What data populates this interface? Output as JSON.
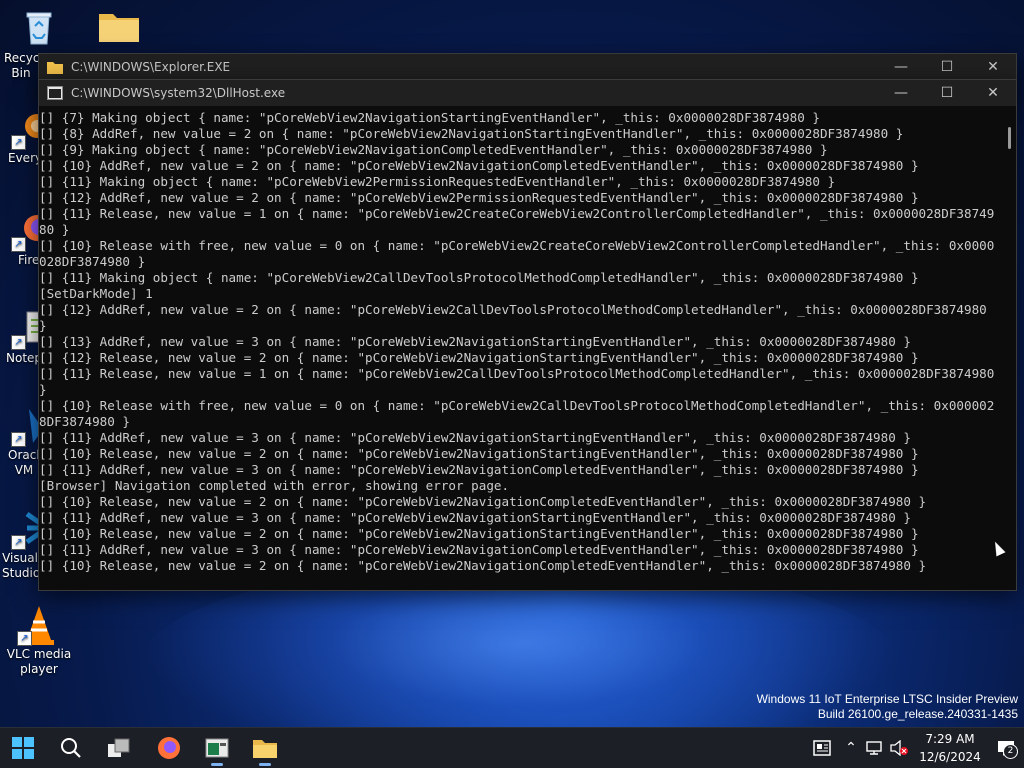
{
  "desktop": {
    "icons": [
      {
        "label": "Recycle Bin",
        "name": "recycle-bin"
      },
      {
        "label": "",
        "name": "folder"
      },
      {
        "label": "Everything",
        "name": "everything"
      },
      {
        "label": "Firefox",
        "name": "firefox"
      },
      {
        "label": "Notepad++",
        "name": "notepadpp"
      },
      {
        "label": "Oracle VM VirtualBox",
        "name": "virtualbox"
      },
      {
        "label": "Visual Studio Code",
        "name": "vscode"
      },
      {
        "label": "VLC media player",
        "name": "vlc"
      }
    ]
  },
  "windows": {
    "explorer": {
      "title": "C:\\WINDOWS\\Explorer.EXE"
    },
    "dllhost": {
      "title": "C:\\WINDOWS\\system32\\DllHost.exe",
      "lines": [
        "[] {7} Making object { name: \"pCoreWebView2NavigationStartingEventHandler\", _this: 0x0000028DF3874980 }",
        "[] {8} AddRef, new value = 2 on { name: \"pCoreWebView2NavigationStartingEventHandler\", _this: 0x0000028DF3874980 }",
        "[] {9} Making object { name: \"pCoreWebView2NavigationCompletedEventHandler\", _this: 0x0000028DF3874980 }",
        "[] {10} AddRef, new value = 2 on { name: \"pCoreWebView2NavigationCompletedEventHandler\", _this: 0x0000028DF3874980 }",
        "[] {11} Making object { name: \"pCoreWebView2PermissionRequestedEventHandler\", _this: 0x0000028DF3874980 }",
        "[] {12} AddRef, new value = 2 on { name: \"pCoreWebView2PermissionRequestedEventHandler\", _this: 0x0000028DF3874980 }",
        "[] {11} Release, new value = 1 on { name: \"pCoreWebView2CreateCoreWebView2ControllerCompletedHandler\", _this: 0x0000028DF3874980 }",
        "[] {10} Release with free, new value = 0 on { name: \"pCoreWebView2CreateCoreWebView2ControllerCompletedHandler\", _this: 0x0000028DF3874980 }",
        "[] {11} Making object { name: \"pCoreWebView2CallDevToolsProtocolMethodCompletedHandler\", _this: 0x0000028DF3874980 }",
        "[SetDarkMode] 1",
        "[] {12} AddRef, new value = 2 on { name: \"pCoreWebView2CallDevToolsProtocolMethodCompletedHandler\", _this: 0x0000028DF3874980 }",
        "[] {13} AddRef, new value = 3 on { name: \"pCoreWebView2NavigationStartingEventHandler\", _this: 0x0000028DF3874980 }",
        "[] {12} Release, new value = 2 on { name: \"pCoreWebView2NavigationStartingEventHandler\", _this: 0x0000028DF3874980 }",
        "[] {11} Release, new value = 1 on { name: \"pCoreWebView2CallDevToolsProtocolMethodCompletedHandler\", _this: 0x0000028DF3874980 }",
        "[] {10} Release with free, new value = 0 on { name: \"pCoreWebView2CallDevToolsProtocolMethodCompletedHandler\", _this: 0x0000028DF3874980 }",
        "[] {11} AddRef, new value = 3 on { name: \"pCoreWebView2NavigationStartingEventHandler\", _this: 0x0000028DF3874980 }",
        "[] {10} Release, new value = 2 on { name: \"pCoreWebView2NavigationStartingEventHandler\", _this: 0x0000028DF3874980 }",
        "[] {11} AddRef, new value = 3 on { name: \"pCoreWebView2NavigationCompletedEventHandler\", _this: 0x0000028DF3874980 }",
        "[Browser] Navigation completed with error, showing error page.",
        "[] {10} Release, new value = 2 on { name: \"pCoreWebView2NavigationCompletedEventHandler\", _this: 0x0000028DF3874980 }",
        "[] {11} AddRef, new value = 3 on { name: \"pCoreWebView2NavigationStartingEventHandler\", _this: 0x0000028DF3874980 }",
        "[] {10} Release, new value = 2 on { name: \"pCoreWebView2NavigationStartingEventHandler\", _this: 0x0000028DF3874980 }",
        "[] {11} AddRef, new value = 3 on { name: \"pCoreWebView2NavigationCompletedEventHandler\", _this: 0x0000028DF3874980 }",
        "[] {10} Release, new value = 2 on { name: \"pCoreWebView2NavigationCompletedEventHandler\", _this: 0x0000028DF3874980 }"
      ]
    }
  },
  "watermark": {
    "line1": "Windows 11 IoT Enterprise LTSC Insider Preview",
    "line2": "Build 26100.ge_release.240331-1435"
  },
  "taskbar": {
    "time": "7:29 AM",
    "date": "12/6/2024",
    "notification_count": "2",
    "accent": "#7fb2f0"
  }
}
